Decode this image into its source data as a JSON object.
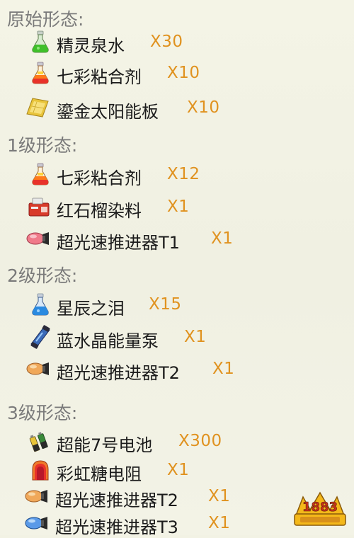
{
  "tiers": [
    {
      "header": "原始形态:",
      "items": [
        {
          "icon": "green-potion-flask-icon",
          "name": "精灵泉水",
          "qty": "X30"
        },
        {
          "icon": "rainbow-potion-flask-icon",
          "name": "七彩粘合剂",
          "qty": "X10"
        },
        {
          "icon": "gold-solar-panel-icon",
          "name": "鎏金太阳能板",
          "qty": "X10"
        }
      ]
    },
    {
      "header": "1级形态:",
      "items": [
        {
          "icon": "rainbow-potion-flask-icon",
          "name": "七彩粘合剂",
          "qty": "X12"
        },
        {
          "icon": "red-dye-box-icon",
          "name": "红石榴染料",
          "qty": "X1"
        },
        {
          "icon": "pink-thruster-icon",
          "name": "超光速推进器T1",
          "qty": "X1"
        }
      ]
    },
    {
      "header": "2级形态:",
      "items": [
        {
          "icon": "blue-potion-flask-icon",
          "name": "星辰之泪",
          "qty": "X15"
        },
        {
          "icon": "blue-crystal-pump-icon",
          "name": "蓝水晶能量泵",
          "qty": "X1"
        },
        {
          "icon": "orange-thruster-icon",
          "name": "超光速推进器T2",
          "qty": "X1"
        }
      ]
    },
    {
      "header": "3级形态:",
      "items": [
        {
          "icon": "battery-icon",
          "name": "超能7号电池",
          "qty": "X300"
        },
        {
          "icon": "rainbow-resistor-icon",
          "name": "彩虹糖电阻",
          "qty": "X1"
        },
        {
          "icon": "orange-thruster-icon",
          "name": "超光速推进器T2",
          "qty": "X1"
        },
        {
          "icon": "blue-thruster-icon",
          "name": "超光速推进器T3",
          "qty": "X1"
        }
      ]
    }
  ],
  "colors": {
    "header": "#7a7a7a",
    "name": "#1c1c1c",
    "qty": "#e0921f",
    "background": "#f2f2e4"
  },
  "watermark": {
    "icon": "1883-logo-icon",
    "text": "1883"
  }
}
